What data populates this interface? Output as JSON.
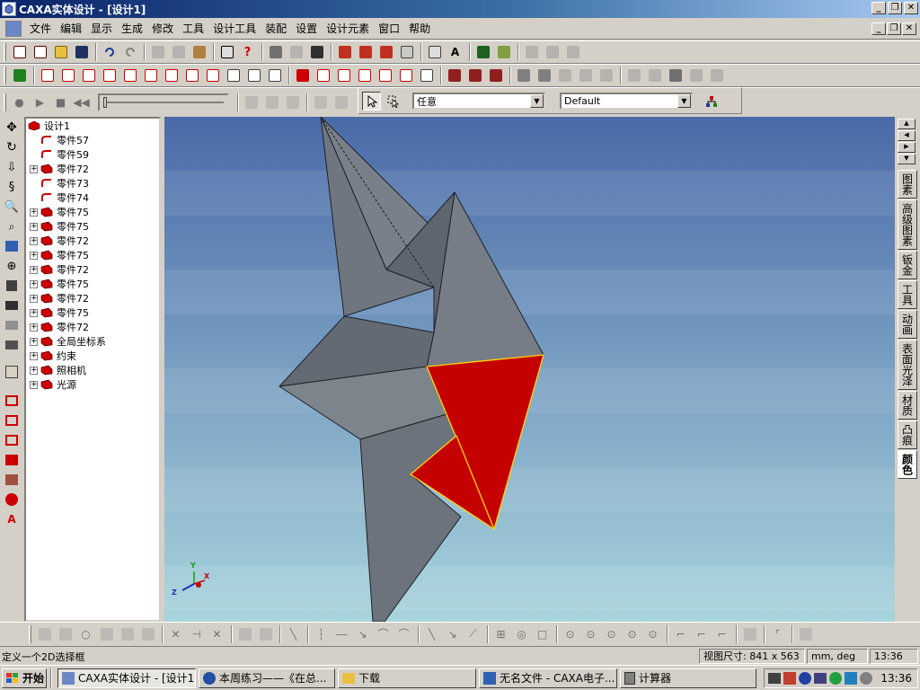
{
  "window": {
    "title": "CAXA实体设计 - [设计1]"
  },
  "menu": [
    "文件",
    "编辑",
    "显示",
    "生成",
    "修改",
    "工具",
    "设计工具",
    "装配",
    "设置",
    "设计元素",
    "窗口",
    "帮助"
  ],
  "toolbar": {
    "select_mode": "任意",
    "scheme": "Default"
  },
  "tree": {
    "root": "设计1",
    "items": [
      {
        "label": "零件57",
        "expandable": false
      },
      {
        "label": "零件59",
        "expandable": false
      },
      {
        "label": "零件72",
        "expandable": true
      },
      {
        "label": "零件73",
        "expandable": false
      },
      {
        "label": "零件74",
        "expandable": false
      },
      {
        "label": "零件75",
        "expandable": true
      },
      {
        "label": "零件75",
        "expandable": true
      },
      {
        "label": "零件72",
        "expandable": true
      },
      {
        "label": "零件75",
        "expandable": true
      },
      {
        "label": "零件72",
        "expandable": true
      },
      {
        "label": "零件75",
        "expandable": true
      },
      {
        "label": "零件72",
        "expandable": true
      },
      {
        "label": "零件75",
        "expandable": true
      },
      {
        "label": "零件72",
        "expandable": true
      },
      {
        "label": "全局坐标系",
        "expandable": true
      },
      {
        "label": "约束",
        "expandable": true
      },
      {
        "label": "照相机",
        "expandable": true
      },
      {
        "label": "光源",
        "expandable": true
      }
    ]
  },
  "right_tabs": [
    "图素",
    "高级图素",
    "钣金",
    "工具",
    "动画",
    "表面光泽",
    "材质",
    "凸痕",
    "颜色"
  ],
  "right_tabs_active": "颜色",
  "axes": {
    "x": "X",
    "y": "Y",
    "z": "Z"
  },
  "status": {
    "message": "定义一个2D选择框",
    "view_size_label": "视图尺寸:",
    "view_size_value": "841 x 563",
    "units": "mm, deg",
    "time": "13:36"
  },
  "taskbar": {
    "start": "开始",
    "tasks": [
      "CAXA实体设计 - [设计1]",
      "本周练习——《在总...",
      "下载",
      "无名文件 - CAXA电子...",
      "计算器"
    ],
    "active_task": 0,
    "clock": "13:36"
  },
  "colors": {
    "selected_face": "#c40000",
    "selection_edge": "#ffd700",
    "part_gray": "#767d86",
    "viewport_top": "#4a6aa8",
    "viewport_bottom": "#a8d4dc"
  }
}
